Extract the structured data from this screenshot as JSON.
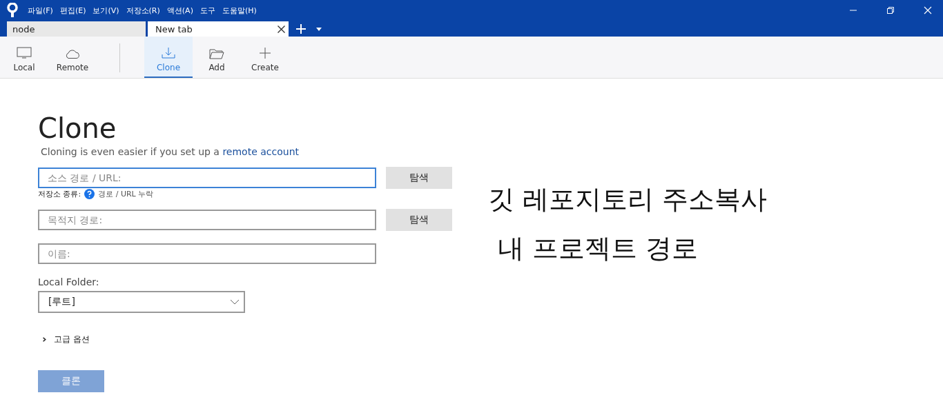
{
  "menu": [
    "파일(F)",
    "편집(E)",
    "보기(V)",
    "저장소(R)",
    "액션(A)",
    "도구",
    "도움말(H)"
  ],
  "tabs": [
    {
      "label": "node",
      "selected": false
    },
    {
      "label": "New tab",
      "selected": true
    }
  ],
  "toolbar": [
    {
      "label": "Local",
      "selected": false
    },
    {
      "label": "Remote",
      "selected": false
    },
    {
      "label": "Clone",
      "selected": true
    },
    {
      "label": "Add",
      "selected": false
    },
    {
      "label": "Create",
      "selected": false
    }
  ],
  "page": {
    "title": "Clone",
    "subtitle": "Cloning is even easier if you set up a ",
    "subtitle_link": "remote account",
    "fields": [
      {
        "placeholder": "소스 경로 / URL:",
        "focused": true,
        "button": "탐색",
        "hint_label": "저장소 종류:",
        "hint_text": "경로 / URL 누락"
      },
      {
        "placeholder": "목적지 경로:",
        "focused": false,
        "button": "탐색"
      },
      {
        "placeholder": "이름:",
        "focused": false
      }
    ],
    "local_folder_label": "Local Folder:",
    "local_folder_value": "[루트]",
    "advanced": {
      "label": "고급 옵션",
      "expanded": false
    },
    "clone_button": {
      "label": "클론",
      "disabled": true
    }
  },
  "annotations": [
    "깃 레포지토리 주소복사",
    "내 프로젝트 경로"
  ]
}
